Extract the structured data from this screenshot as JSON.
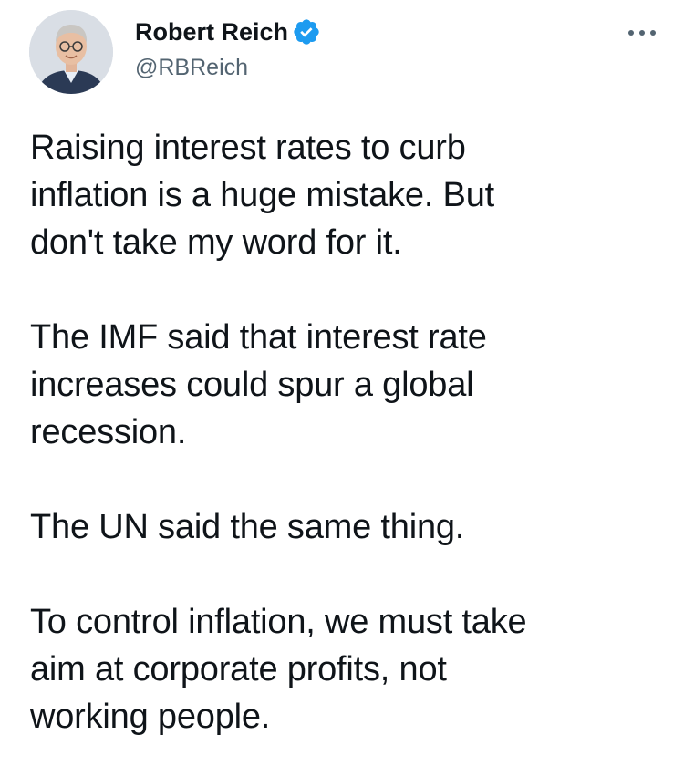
{
  "author": {
    "name": "Robert Reich",
    "handle": "@RBReich",
    "verified": true,
    "avatar_icon": "profile-photo"
  },
  "more_icon": "ellipsis-icon",
  "tweet": {
    "paragraphs": [
      "Raising interest rates to curb\ninflation is a huge mistake. But\ndon't take my word for it.",
      "The IMF said that interest rate\nincreases could spur a global\nrecession.",
      "The UN said the same thing.",
      "To control inflation, we must take\naim at corporate profits, not\nworking people."
    ]
  },
  "colors": {
    "text": "#0f1419",
    "secondary": "#536471",
    "verified_badge": "#1d9bf0",
    "background": "#ffffff"
  }
}
